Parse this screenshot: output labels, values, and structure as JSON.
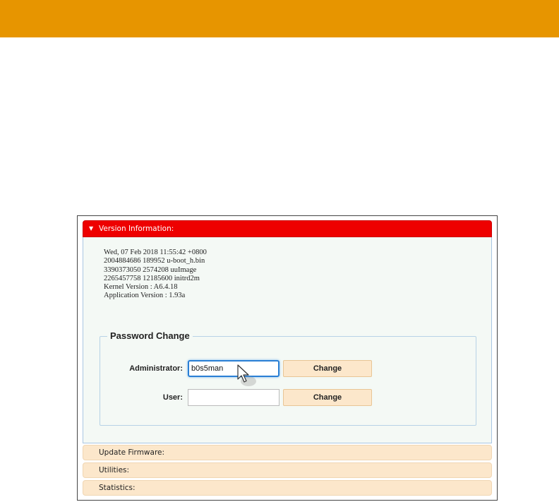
{
  "accordion": {
    "version_info": {
      "title": "Version Information:",
      "lines": [
        "Wed, 07 Feb 2018 11:55:42 +0800",
        "2004884686 189952 u-boot_h.bin",
        "3390373050 2574208 uuImage",
        "2265457758 12185600 initrd2m",
        "Kernel Version : A6.4.18",
        "Application Version : 1.93a"
      ]
    },
    "password_change": {
      "legend": "Password Change",
      "admin_label": "Administrator:",
      "admin_value": "b0s5man",
      "user_label": "User:",
      "user_value": "",
      "change_label": "Change"
    },
    "sections": [
      {
        "title": "Update Firmware:"
      },
      {
        "title": "Utilities:"
      },
      {
        "title": "Statistics:"
      }
    ]
  },
  "colors": {
    "top_bar": "#e79500",
    "active_header": "#ee0000",
    "inactive_header": "#fce7cb",
    "focus_border": "#2a7fd4"
  },
  "icons": {
    "expand": "triangle-down-icon",
    "cursor": "mouse-pointer-icon"
  }
}
